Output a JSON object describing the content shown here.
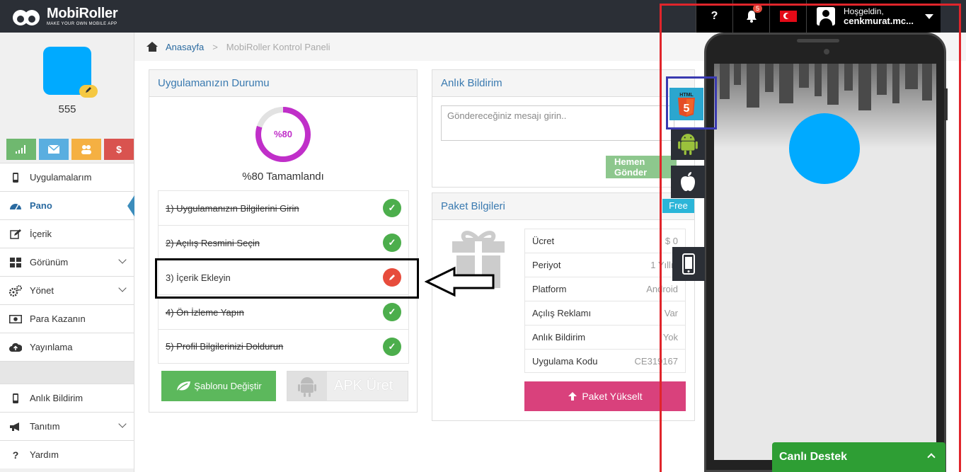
{
  "header": {
    "logo_name": "MobiRoller",
    "logo_tagline": "MAKE YOUR OWN MOBILE APP",
    "help_label": "?",
    "notification_count": "5",
    "user_greeting": "Hoşgeldin,",
    "user_name": "cenkmurat.mc..."
  },
  "sidebar": {
    "app_name": "555",
    "items": [
      {
        "label": "Uygulamalarım"
      },
      {
        "label": "Pano"
      },
      {
        "label": "İçerik"
      },
      {
        "label": "Görünüm"
      },
      {
        "label": "Yönet"
      },
      {
        "label": "Para Kazanın"
      },
      {
        "label": "Yayınlama"
      },
      {
        "label": "Anlık Bildirim"
      },
      {
        "label": "Tanıtım"
      },
      {
        "label": "Yardım"
      }
    ]
  },
  "breadcrumb": {
    "home": "Anasayfa",
    "separator": ">",
    "current": "MobiRoller Kontrol Paneli"
  },
  "status_panel": {
    "title": "Uygulamanızın Durumu",
    "progress_label": "%80",
    "progress_fraction": 0.8,
    "completed_text": "%80 Tamamlandı",
    "steps": [
      {
        "label": "1) Uygulamanızın Bilgilerini Girin",
        "done": true
      },
      {
        "label": "2) Açılış Resmini Seçin",
        "done": true
      },
      {
        "label": "3) İçerik Ekleyin",
        "done": false
      },
      {
        "label": "4) Ön İzleme Yapın",
        "done": true
      },
      {
        "label": "5) Profil Bilgilerinizi Doldurun",
        "done": true
      }
    ],
    "template_button": "Şablonu Değiştir",
    "apk_button": "APK Üret"
  },
  "notify_panel": {
    "title": "Anlık Bildirim",
    "placeholder": "Göndereceğiniz mesajı girin..",
    "send_button": "Hemen Gönder"
  },
  "package_panel": {
    "title": "Paket Bilgileri",
    "badge": "Free",
    "rows": [
      {
        "key": "Ücret",
        "value": "$ 0"
      },
      {
        "key": "Periyot",
        "value": "1 Yıllık"
      },
      {
        "key": "Platform",
        "value": "Android"
      },
      {
        "key": "Açılış Reklamı",
        "value": "Var"
      },
      {
        "key": "Anlık Bildirim",
        "value": "Yok"
      },
      {
        "key": "Uygulama Kodu",
        "value": "CE319167"
      }
    ],
    "upgrade_button": "Paket Yükselt"
  },
  "preview": {
    "html5_label": "HTML"
  },
  "live_support": {
    "label": "Canlı Destek"
  },
  "colors": {
    "accent": "#3c8dbc",
    "progress": "#c02fc9",
    "success": "#5cb85c",
    "danger": "#e74c3c",
    "upgrade": "#d9417c",
    "live": "#2e9e34",
    "app_icon": "#00aaff"
  }
}
